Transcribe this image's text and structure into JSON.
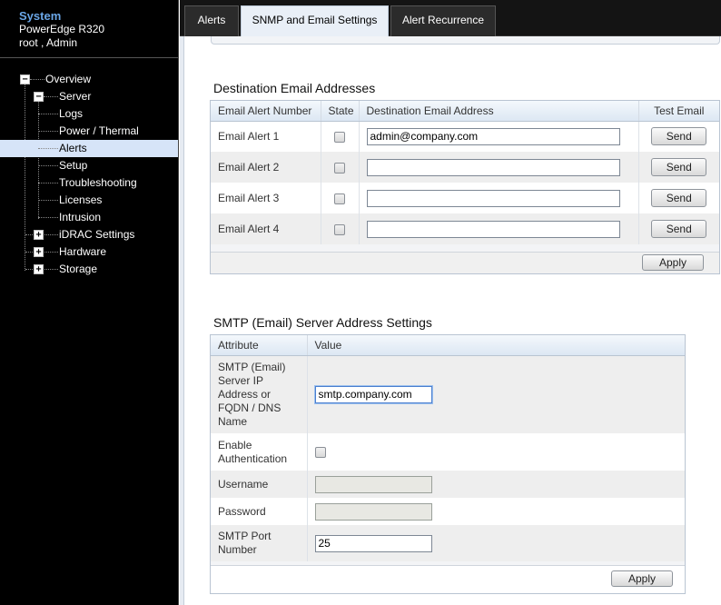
{
  "system": {
    "title": "System",
    "model": "PowerEdge R320",
    "user": "root , Admin"
  },
  "tree": {
    "overview": "Overview",
    "server": "Server",
    "logs": "Logs",
    "power_thermal": "Power / Thermal",
    "alerts": "Alerts",
    "setup": "Setup",
    "troubleshooting": "Troubleshooting",
    "licenses": "Licenses",
    "intrusion": "Intrusion",
    "idrac_settings": "iDRAC Settings",
    "hardware": "Hardware",
    "storage": "Storage"
  },
  "tabs": [
    {
      "label": "Alerts"
    },
    {
      "label": "SNMP and Email Settings"
    },
    {
      "label": "Alert Recurrence"
    }
  ],
  "email_section": {
    "title": "Destination Email Addresses",
    "headers": {
      "number": "Email Alert Number",
      "state": "State",
      "address": "Destination Email Address",
      "test": "Test Email"
    },
    "rows": [
      {
        "label": "Email Alert 1",
        "address": "admin@company.com",
        "send": "Send"
      },
      {
        "label": "Email Alert 2",
        "address": "",
        "send": "Send"
      },
      {
        "label": "Email Alert 3",
        "address": "",
        "send": "Send"
      },
      {
        "label": "Email Alert 4",
        "address": "",
        "send": "Send"
      }
    ],
    "apply_label": "Apply"
  },
  "smtp_section": {
    "title": "SMTP (Email) Server Address Settings",
    "headers": {
      "attribute": "Attribute",
      "value": "Value"
    },
    "server_label": "SMTP (Email) Server IP Address or FQDN / DNS Name",
    "server_value": "smtp.company.com",
    "auth_label": "Enable Authentication",
    "username_label": "Username",
    "password_label": "Password",
    "port_label": "SMTP Port Number",
    "port_value": "25",
    "apply_label": "Apply"
  }
}
